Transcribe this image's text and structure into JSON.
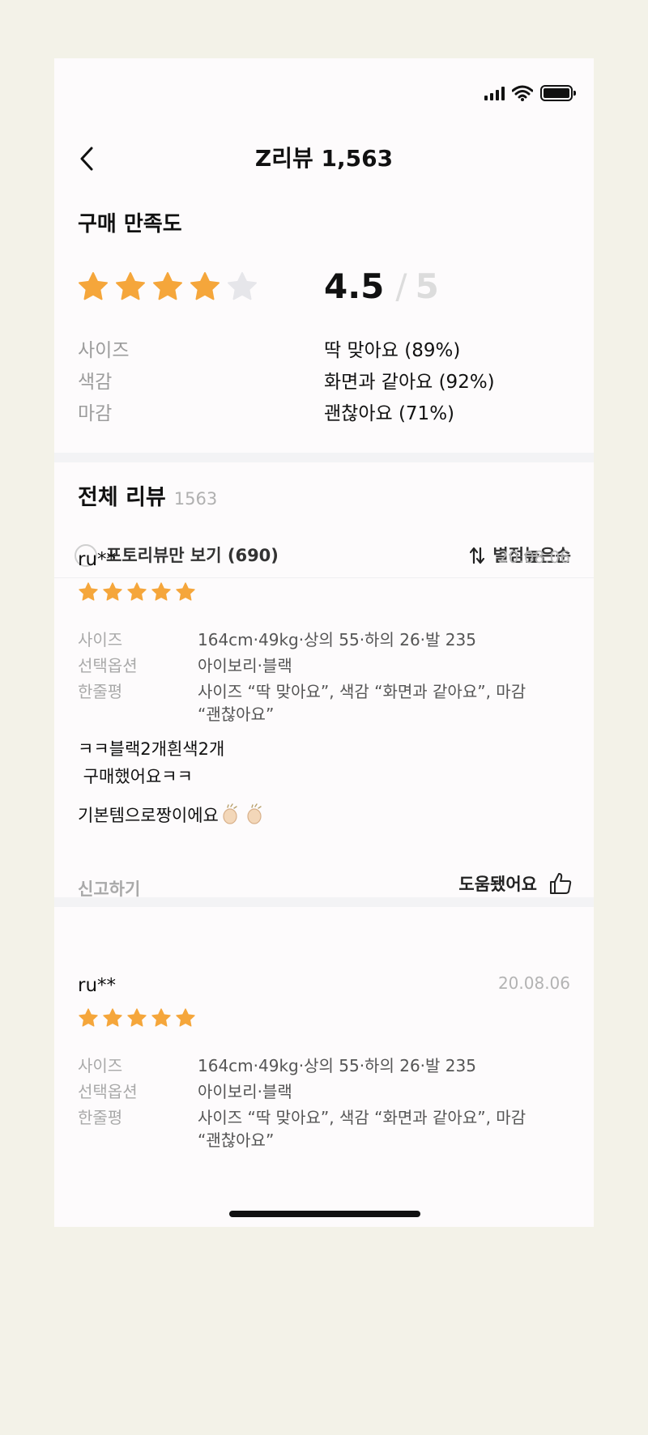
{
  "nav": {
    "title": "Z리뷰 1,563",
    "back_icon": "chevron-left-icon"
  },
  "satisfaction": {
    "title": "구매 만족도",
    "rating": 4,
    "rating_max": 5,
    "score": "4.5",
    "slash": "/",
    "score_max": "5",
    "attributes": [
      {
        "label": "사이즈",
        "value": "딱 맞아요 (89%)"
      },
      {
        "label": "색감",
        "value": "화면과 같아요 (92%)"
      },
      {
        "label": "마감",
        "value": "괜찮아요 (71%)"
      }
    ]
  },
  "all_reviews": {
    "title": "전체 리뷰",
    "count": "1563",
    "photo_filter_label": "포토리뷰만 보기 (690)",
    "sort_label": "별점높은순"
  },
  "reviews": [
    {
      "user": "ru**",
      "date": "20.08.06",
      "stars": 5,
      "meta": [
        {
          "label": "사이즈",
          "value": "164cm·49kg·상의 55·하의 26·발 235"
        },
        {
          "label": "선택옵션",
          "value": "아이보리·블랙"
        },
        {
          "label": "한줄평",
          "value": "사이즈 “딱 맞아요”, 색감 “화면과 같아요”, 마감 “괜찮아요”"
        }
      ],
      "body_line1": "ㅋㅋ블랙2개흰색2개",
      "body_line2": " 구매했어요ㅋㅋ",
      "body_line3": "기본템으로짱이에요",
      "report_label": "신고하기",
      "helpful_label": "도움됐어요"
    },
    {
      "user": "ru**",
      "date": "20.08.06",
      "stars": 5,
      "meta": [
        {
          "label": "사이즈",
          "value": "164cm·49kg·상의 55·하의 26·발 235"
        },
        {
          "label": "선택옵션",
          "value": "아이보리·블랙"
        },
        {
          "label": "한줄평",
          "value": "사이즈 “딱 맞아요”, 색감 “화면과 같아요”, 마감 “괜찮아요”"
        }
      ]
    }
  ],
  "colors": {
    "star": "#f5a63b",
    "star_empty": "#e6e6ea",
    "muted": "#9c9c9c",
    "background": "#fdfbfc",
    "page_bg": "#f3f2e8"
  }
}
